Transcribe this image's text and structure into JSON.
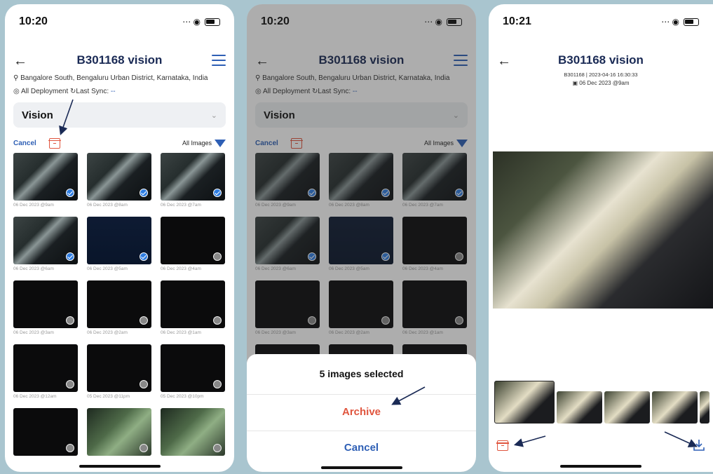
{
  "status": {
    "time_1": "10:20",
    "time_2": "10:20",
    "time_3": "10:21"
  },
  "screen1": {
    "title": "B301168 vision",
    "location": "Bangalore South, Bengaluru Urban District, Karnataka, India",
    "deployment_label": "All Deployment",
    "last_sync_label": "Last Sync:",
    "last_sync_value": "--",
    "dropdown_value": "Vision",
    "cancel_label": "Cancel",
    "all_images_label": "All Images",
    "images": [
      {
        "caption": "06 Dec 2023 @9am",
        "kind": "cam",
        "selected": true
      },
      {
        "caption": "06 Dec 2023 @8am",
        "kind": "cam",
        "selected": true
      },
      {
        "caption": "06 Dec 2023 @7am",
        "kind": "cam",
        "selected": true
      },
      {
        "caption": "06 Dec 2023 @6am",
        "kind": "cam",
        "selected": true
      },
      {
        "caption": "06 Dec 2023 @5am",
        "kind": "blue",
        "selected": true
      },
      {
        "caption": "06 Dec 2023 @4am",
        "kind": "dark",
        "selected": false
      },
      {
        "caption": "06 Dec 2023 @3am",
        "kind": "dark",
        "selected": false
      },
      {
        "caption": "06 Dec 2023 @2am",
        "kind": "dark",
        "selected": false
      },
      {
        "caption": "06 Dec 2023 @1am",
        "kind": "dark",
        "selected": false
      },
      {
        "caption": "06 Dec 2023 @12am",
        "kind": "dark",
        "selected": false
      },
      {
        "caption": "05 Dec 2023 @11pm",
        "kind": "dark",
        "selected": false
      },
      {
        "caption": "05 Dec 2023 @10pm",
        "kind": "dark",
        "selected": false
      },
      {
        "caption": "",
        "kind": "dark",
        "selected": false
      },
      {
        "caption": "",
        "kind": "green",
        "selected": false
      },
      {
        "caption": "",
        "kind": "green",
        "selected": false
      }
    ]
  },
  "screen2": {
    "sheet_title": "5 images selected",
    "archive_label": "Archive",
    "cancel_label": "Cancel"
  },
  "screen3": {
    "title": "B301168 vision",
    "subtitle": "B301168 | 2023-04-16 16:30:33",
    "date_label": "06 Dec 2023 @9am"
  },
  "colors": {
    "accent_blue": "#2e5fb5",
    "archive_red": "#e0553e",
    "background": "#a9c5cf"
  }
}
